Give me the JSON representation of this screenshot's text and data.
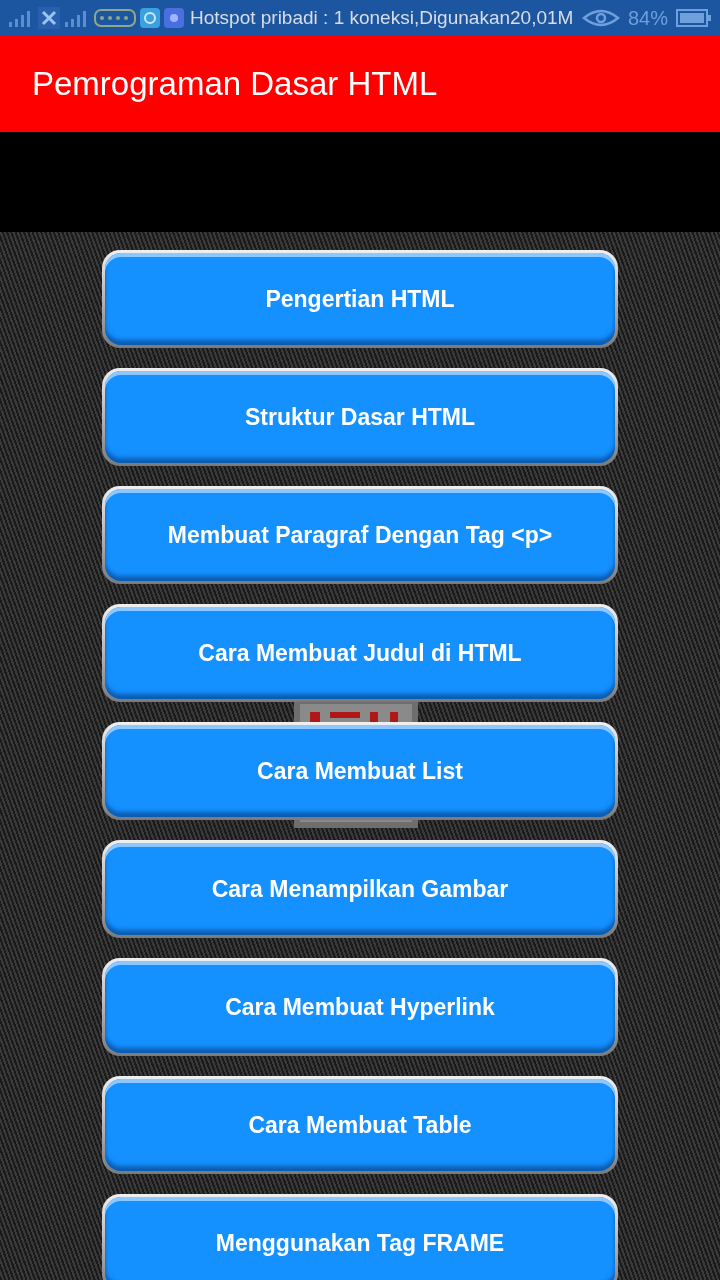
{
  "status_bar": {
    "notification": "Hotspot pribadi : 1 koneksi,Digunakan20,01M",
    "battery": "84%"
  },
  "app_bar": {
    "title": "Pemrograman Dasar HTML"
  },
  "menu_buttons": [
    {
      "label": "Pengertian HTML"
    },
    {
      "label": "Struktur Dasar HTML"
    },
    {
      "label": "Membuat Paragraf Dengan Tag <p>"
    },
    {
      "label": "Cara Membuat Judul di HTML"
    },
    {
      "label": "Cara Membuat List"
    },
    {
      "label": "Cara Menampilkan Gambar"
    },
    {
      "label": "Cara Membuat Hyperlink"
    },
    {
      "label": "Cara Membuat Table"
    },
    {
      "label": "Menggunakan Tag FRAME"
    }
  ]
}
